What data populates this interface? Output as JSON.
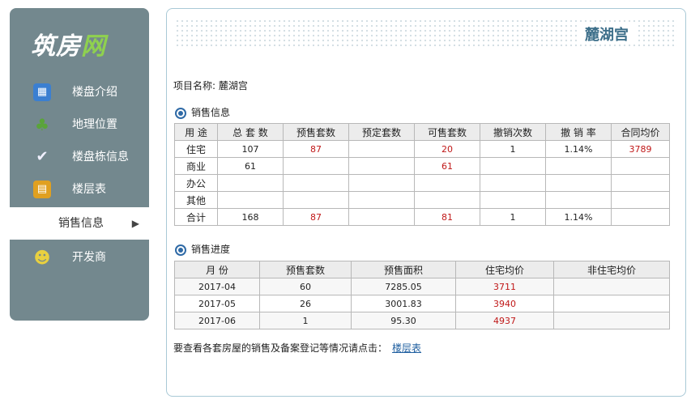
{
  "logo": {
    "part1": "筑房",
    "part2": "网"
  },
  "sidebar": {
    "items": [
      {
        "label": "楼盘介绍",
        "icon": "building-info-icon",
        "color": "#3b7fd1"
      },
      {
        "label": "地理位置",
        "icon": "tree-location-icon",
        "color": "#5aa43a"
      },
      {
        "label": "楼盘栋信息",
        "icon": "v-badge-icon",
        "color": "#6a54c7"
      },
      {
        "label": "楼层表",
        "icon": "floor-chart-icon",
        "color": "#e0a020"
      },
      {
        "label": "销售信息",
        "icon": "",
        "active": true,
        "arrow": "▶"
      },
      {
        "label": "开发商",
        "icon": "developer-icon",
        "color": "#d9c233"
      }
    ]
  },
  "header": {
    "title": "麓湖宫"
  },
  "project": {
    "label": "项目名称:",
    "name": "麓湖宫"
  },
  "sales_info": {
    "title": "销售信息",
    "columns": [
      "用 途",
      "总 套 数",
      "预售套数",
      "预定套数",
      "可售套数",
      "撤销次数",
      "撤 销 率",
      "合同均价"
    ],
    "rows": [
      [
        "住宅",
        "107",
        "87",
        "",
        "20",
        "1",
        "1.14%",
        "3789"
      ],
      [
        "商业",
        "61",
        "",
        "",
        "61",
        "",
        "",
        ""
      ],
      [
        "办公",
        "",
        "",
        "",
        "",
        "",
        "",
        ""
      ],
      [
        "其他",
        "",
        "",
        "",
        "",
        "",
        "",
        ""
      ],
      [
        "合计",
        "168",
        "87",
        "",
        "81",
        "1",
        "1.14%",
        ""
      ]
    ]
  },
  "sales_progress": {
    "title": "销售进度",
    "columns": [
      "月 份",
      "预售套数",
      "预售面积",
      "住宅均价",
      "非住宅均价"
    ],
    "rows": [
      [
        "2017-04",
        "60",
        "7285.05",
        "3711",
        ""
      ],
      [
        "2017-05",
        "26",
        "3001.83",
        "3940",
        ""
      ],
      [
        "2017-06",
        "1",
        "95.30",
        "4937",
        ""
      ]
    ]
  },
  "footer": {
    "text": "要查看各套房屋的销售及备案登记等情况请点击：",
    "link": "楼层表"
  },
  "colors": {
    "sidebar": "#73888e",
    "accent": "#3d6f8a",
    "value_red": "#c01818"
  }
}
